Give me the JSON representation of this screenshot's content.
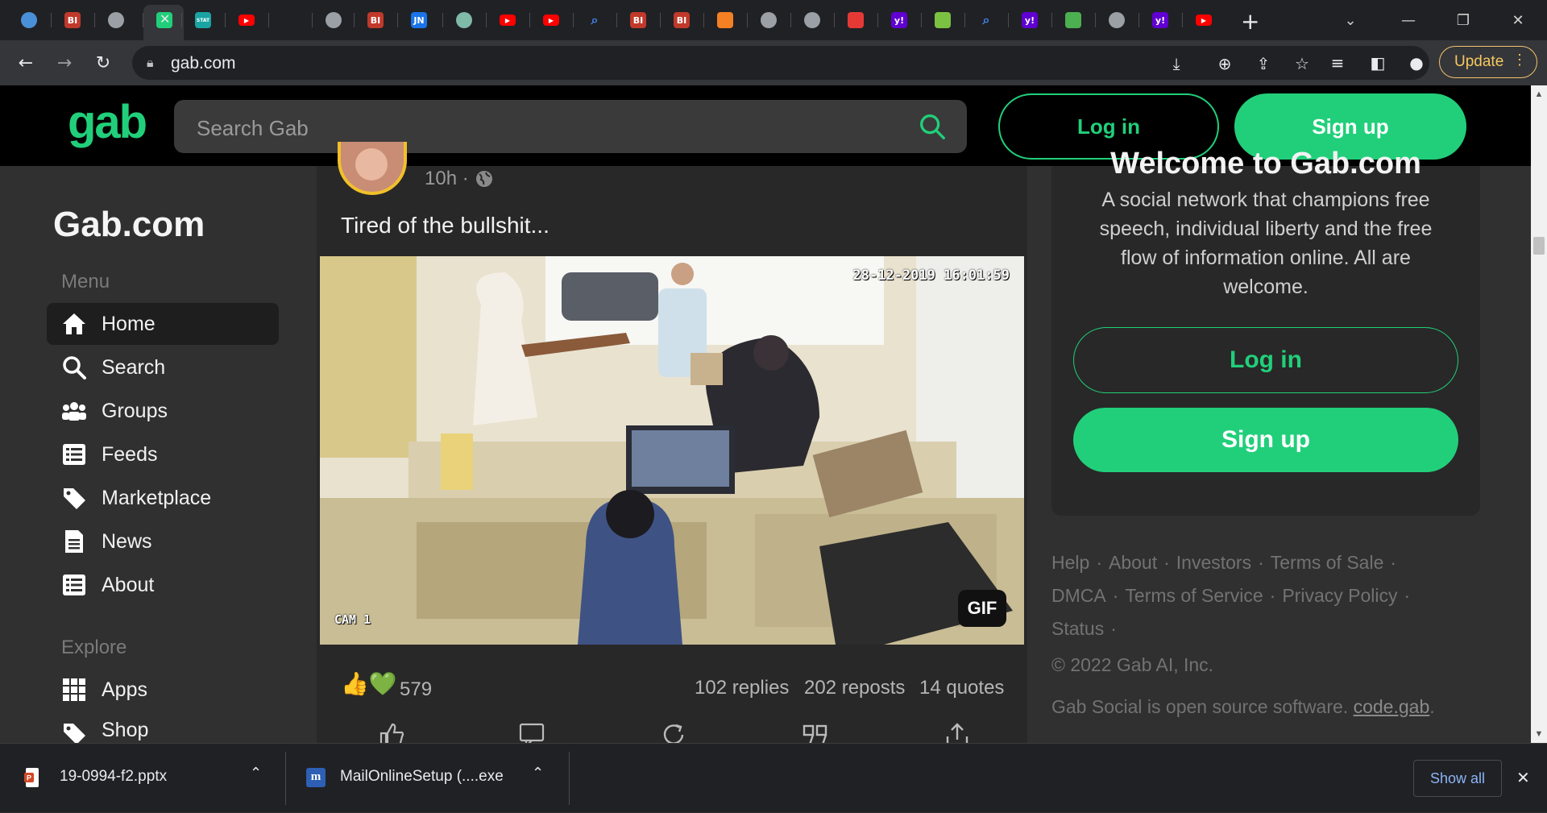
{
  "browser": {
    "tabs": [
      {
        "icon": "globe-icon",
        "label": "",
        "color": "#4a90d9"
      },
      {
        "icon": "bi-icon",
        "label": "BI",
        "color": "#c0392b"
      },
      {
        "icon": "globe-icon",
        "label": "",
        "color": "#9aa0a6"
      },
      {
        "icon": "gab-icon",
        "label": "",
        "color": "#21cf7a"
      },
      {
        "icon": "stat-icon",
        "label": "STAT",
        "color": "#1aa3a3"
      },
      {
        "icon": "youtube-icon",
        "label": "",
        "color": "#ff0000"
      },
      {
        "icon": "blank-icon",
        "label": "",
        "color": "#202124"
      },
      {
        "icon": "globe-icon",
        "label": "",
        "color": "#9aa0a6"
      },
      {
        "icon": "bi-icon",
        "label": "BI",
        "color": "#c0392b"
      },
      {
        "icon": "jn-icon",
        "label": "JN",
        "color": "#1a73e8"
      },
      {
        "icon": "globe-icon",
        "label": "",
        "color": "#7fb9a8"
      },
      {
        "icon": "youtube-icon",
        "label": "",
        "color": "#ff0000"
      },
      {
        "icon": "youtube-icon",
        "label": "",
        "color": "#ff0000"
      },
      {
        "icon": "search-icon",
        "label": "",
        "color": "#4285f4"
      },
      {
        "icon": "bi-icon",
        "label": "BI",
        "color": "#c0392b"
      },
      {
        "icon": "bi-icon",
        "label": "BI",
        "color": "#c0392b"
      },
      {
        "icon": "stack-icon",
        "label": "",
        "color": "#f48024"
      },
      {
        "icon": "globe-icon",
        "label": "",
        "color": "#9aa0a6"
      },
      {
        "icon": "globe-icon",
        "label": "",
        "color": "#9aa0a6"
      },
      {
        "icon": "mic-icon",
        "label": "",
        "color": "#e53935"
      },
      {
        "icon": "yahoo-icon",
        "label": "y!",
        "color": "#6001d2"
      },
      {
        "icon": "play-icon",
        "label": "",
        "color": "#7cc242"
      },
      {
        "icon": "search-icon",
        "label": "",
        "color": "#4285f4"
      },
      {
        "icon": "yahoo-icon",
        "label": "y!",
        "color": "#6001d2"
      },
      {
        "icon": "image-icon",
        "label": "",
        "color": "#4caf50"
      },
      {
        "icon": "globe-icon",
        "label": "",
        "color": "#9aa0a6"
      },
      {
        "icon": "yahoo-icon",
        "label": "y!",
        "color": "#6001d2"
      },
      {
        "icon": "youtube-icon",
        "label": "",
        "color": "#ff0000"
      }
    ],
    "url": "gab.com",
    "update_label": "Update"
  },
  "header": {
    "logo": "gab",
    "search_placeholder": "Search Gab",
    "login_label": "Log in",
    "signup_label": "Sign up"
  },
  "sidebar": {
    "title": "Gab.com",
    "menu_label": "Menu",
    "menu_items": [
      {
        "label": "Home",
        "icon": "home-icon",
        "active": true
      },
      {
        "label": "Search",
        "icon": "search-icon"
      },
      {
        "label": "Groups",
        "icon": "groups-icon"
      },
      {
        "label": "Feeds",
        "icon": "feeds-icon"
      },
      {
        "label": "Marketplace",
        "icon": "tag-icon"
      },
      {
        "label": "News",
        "icon": "news-icon"
      },
      {
        "label": "About",
        "icon": "list-icon"
      }
    ],
    "explore_label": "Explore",
    "explore_items": [
      {
        "label": "Apps",
        "icon": "apps-icon"
      },
      {
        "label": "Shop",
        "icon": "tag-icon"
      }
    ]
  },
  "post": {
    "time": "10h",
    "dot": "·",
    "text": "Tired of the bullshit...",
    "media_timestamp": "28-12-2019 16:01:59",
    "media_cam": "CAM 1",
    "media_badge": "GIF",
    "reaction_emojis": "👍💚",
    "reaction_count": "579",
    "replies": "102 replies",
    "reposts": "202 reposts",
    "quotes": "14 quotes"
  },
  "welcome": {
    "heading": "Welcome to Gab.com",
    "description": "A social network that champions free speech, individual liberty and the free flow of information online. All are welcome.",
    "login_label": "Log in",
    "signup_label": "Sign up"
  },
  "footer": {
    "links": [
      "Help",
      "About",
      "Investors",
      "Terms of Sale",
      "DMCA",
      "Terms of Service",
      "Privacy Policy",
      "Status"
    ],
    "separator": "·",
    "copyright": "© 2022 Gab AI, Inc.",
    "opensource_prefix": "Gab Social is open source software.",
    "opensource_link": "code.gab",
    "opensource_suffix": "."
  },
  "downloads": {
    "items": [
      {
        "name": "19-0994-f2.pptx",
        "icon": "pptx-icon"
      },
      {
        "name": "MailOnlineSetup (....exe",
        "icon": "exe-icon"
      }
    ],
    "show_all_label": "Show all"
  },
  "colors": {
    "accent": "#21cf7a",
    "background": "#303030",
    "card": "#282828",
    "header": "#000000"
  }
}
